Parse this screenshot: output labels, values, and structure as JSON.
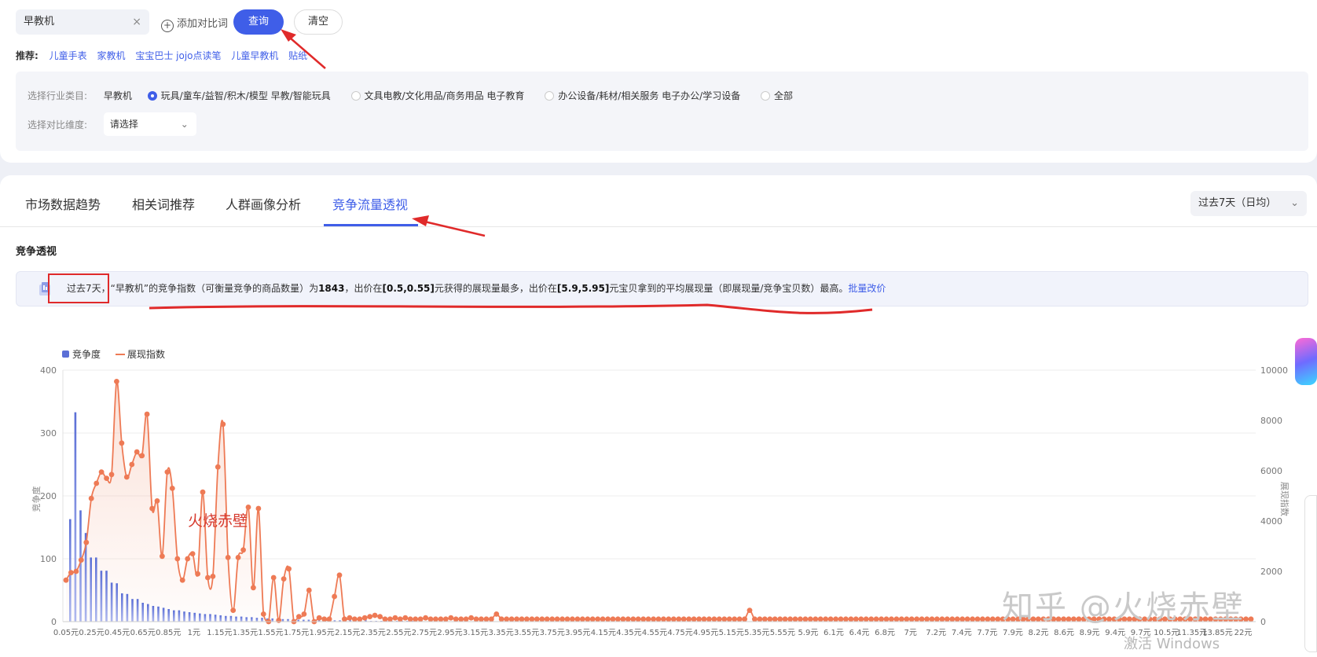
{
  "search": {
    "value": "早教机",
    "clear_icon": "close-icon"
  },
  "actions": {
    "add_compare": "添加对比词",
    "query": "查询",
    "clear": "清空"
  },
  "recommend": {
    "label": "推荐:",
    "items": [
      "儿童手表",
      "家教机",
      "宝宝巴士 jojo点读笔",
      "儿童早教机",
      "贴纸"
    ]
  },
  "filter": {
    "industry_label": "选择行业类目:",
    "industry_value": "早教机",
    "options": [
      {
        "label": "玩具/童车/益智/积木/模型 早教/智能玩具",
        "selected": true
      },
      {
        "label": "文具电教/文化用品/商务用品 电子教育",
        "selected": false
      },
      {
        "label": "办公设备/耗材/相关服务 电子办公/学习设备",
        "selected": false
      },
      {
        "label": "全部",
        "selected": false
      }
    ],
    "dimension_label": "选择对比维度:",
    "dimension_placeholder": "请选择"
  },
  "tabs": [
    "市场数据趋势",
    "相关词推荐",
    "人群画像分析",
    "竞争流量透视"
  ],
  "active_tab": 3,
  "period": "过去7天（日均）",
  "section_title": "竞争透视",
  "banner": {
    "p1": "过去7天，",
    "p2": "“早教机”的竞争指数（可衡量竞争的商品数量）为",
    "v1": "1843",
    "p3": "，出价在",
    "v2": "[0.5,0.55]",
    "p4": "元获得的展现量最多，出价在",
    "v3": "[5.9,5.95]",
    "p5": "元宝贝拿到的平均展现量（即展现量/竞争宝贝数）最高。",
    "link": "批量改价"
  },
  "annotation": "火烧赤壁",
  "watermark": "知乎 @火烧赤壁",
  "windows_text": "激活 Windows",
  "colors": {
    "accent": "#3f5ee8",
    "bar": "#5b6fd6",
    "line": "#ee7a55",
    "arrow": "#e02a2a"
  },
  "chart_data": {
    "type": "bar+line",
    "legend": [
      "竞争度",
      "展现指数"
    ],
    "ylabel_left": "竞争度",
    "ylabel_right": "展现指数",
    "ylim_left": [
      0,
      400
    ],
    "ylim_right": [
      0,
      10000
    ],
    "left_ticks": [
      0,
      100,
      200,
      300,
      400
    ],
    "right_ticks": [
      0,
      2000,
      4000,
      6000,
      8000,
      10000
    ],
    "x_tick_labels": [
      "0.05元",
      "0.25元",
      "0.45元",
      "0.65元",
      "0.85元",
      "1元",
      "1.15元",
      "1.35元",
      "1.55元",
      "1.75元",
      "1.95元",
      "2.15元",
      "2.35元",
      "2.55元",
      "2.75元",
      "2.95元",
      "3.15元",
      "3.35元",
      "3.55元",
      "3.75元",
      "3.95元",
      "4.15元",
      "4.35元",
      "4.55元",
      "4.75元",
      "4.95元",
      "5.15元",
      "5.35元",
      "5.55元",
      "5.9元",
      "6.1元",
      "6.4元",
      "6.8元",
      "7元",
      "7.2元",
      "7.4元",
      "7.7元",
      "7.9元",
      "8.2元",
      "8.6元",
      "8.9元",
      "9.4元",
      "9.7元",
      "10.5元",
      "11.35元",
      "13.85元",
      "22元"
    ],
    "competition": [
      163,
      333,
      177,
      141,
      102,
      102,
      81,
      81,
      62,
      61,
      45,
      44,
      36,
      36,
      30,
      28,
      25,
      24,
      22,
      20,
      18,
      18,
      16,
      15,
      14,
      13,
      12,
      12,
      11,
      10,
      9,
      9,
      8,
      8,
      7,
      7,
      6,
      6,
      5,
      5,
      5,
      4,
      4,
      4,
      3,
      3,
      3,
      3,
      3,
      2,
      2,
      2,
      2,
      2,
      2,
      2,
      2,
      2,
      1,
      1,
      1,
      1,
      1,
      1,
      1,
      1,
      1
    ],
    "exposure": [
      1650,
      1950,
      2000,
      2450,
      3150,
      4900,
      5500,
      5950,
      5700,
      5850,
      9550,
      7100,
      5750,
      6250,
      6750,
      6600,
      8250,
      4500,
      4800,
      2600,
      5950,
      5300,
      2500,
      1650,
      2500,
      2700,
      1900,
      5150,
      1750,
      1800,
      6150,
      7850,
      2550,
      450,
      2550,
      2850,
      4550,
      1350,
      4500,
      300,
      0,
      1750,
      50,
      1700,
      2100,
      0,
      200,
      300,
      1250,
      0,
      150,
      100,
      100,
      1000,
      1850,
      100,
      150,
      100,
      100,
      150,
      200,
      250,
      200,
      100,
      100,
      150,
      100,
      150,
      100,
      100,
      100,
      150,
      100,
      100,
      100,
      100,
      150,
      100,
      100,
      100,
      150,
      100,
      100,
      100,
      100,
      300,
      100,
      100,
      100,
      100,
      100,
      100,
      100,
      100,
      100,
      100,
      100,
      100,
      100,
      100,
      100,
      100,
      100,
      100,
      100,
      100,
      100,
      100,
      100,
      100,
      100,
      100,
      100,
      100,
      100,
      100,
      100,
      100,
      100,
      100,
      100,
      100,
      100,
      100,
      100,
      100,
      100,
      100,
      100,
      100,
      100,
      100,
      100,
      100,
      100,
      450,
      100,
      100,
      100,
      100,
      100,
      100,
      100,
      100,
      100,
      100,
      100,
      100,
      100,
      100,
      100,
      100,
      100,
      100,
      100,
      100,
      100,
      100,
      100,
      100,
      100,
      100,
      100,
      100,
      100,
      100,
      100,
      100,
      100,
      100,
      100,
      100,
      100,
      100,
      100,
      100,
      100,
      100,
      100,
      100,
      100,
      100,
      100,
      100,
      100,
      100,
      100,
      100,
      100,
      100,
      100,
      100,
      100,
      100,
      100,
      100,
      100,
      100,
      100,
      100,
      100,
      100,
      100,
      100,
      100,
      100,
      100,
      100,
      100,
      100,
      100,
      100,
      100,
      100,
      100,
      100,
      100,
      100,
      100,
      100,
      100,
      100,
      100,
      100,
      100,
      100,
      100,
      100,
      100,
      100,
      100,
      100,
      100,
      100,
      100
    ]
  }
}
